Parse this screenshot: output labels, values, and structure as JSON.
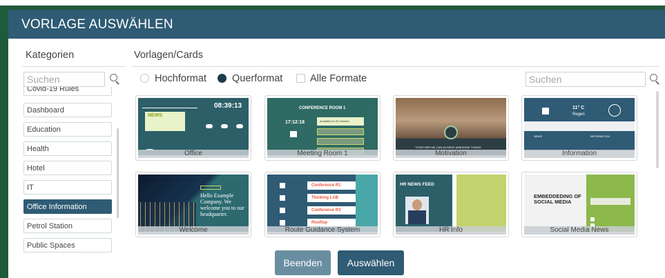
{
  "dialog": {
    "title": "VORLAGE AUSWÄHLEN"
  },
  "categories": {
    "header": "Kategorien",
    "search_placeholder": "Suchen",
    "items": [
      "Covid-19 Rules",
      "Dashboard",
      "Education",
      "Health",
      "Hotel",
      "IT",
      "Office Information",
      "Petrol Station",
      "Public Spaces"
    ],
    "selected": "Office Information"
  },
  "templates": {
    "header": "Vorlagen/Cards",
    "search_placeholder": "Suchen",
    "formats": [
      {
        "label": "Hochformat",
        "type": "radio",
        "checked": false
      },
      {
        "label": "Querformat",
        "type": "radio",
        "checked": true
      },
      {
        "label": "Alle Formate",
        "type": "checkbox",
        "checked": false
      }
    ],
    "cards": [
      {
        "caption": "Office",
        "thumb": {
          "clock": "08:39:13",
          "heading": "NEWS"
        }
      },
      {
        "caption": "Meeting Room 1",
        "thumb": {
          "heading": "CONFERENCE ROOM 1",
          "time": "17:12:18",
          "status": "Available for 33 minutes"
        }
      },
      {
        "caption": "Motivation",
        "thumb": {
          "slogan": "TOGETHER WE CAN ACHIEVE AWESOME THINGS"
        }
      },
      {
        "caption": "Information",
        "thumb": {
          "temp": "11° C",
          "weather": "Regen",
          "news": "NEWS",
          "info": "INFORMATION"
        }
      },
      {
        "caption": "Welcome",
        "thumb": {
          "text": "Hello Example Company. We welcome you to our headquarter."
        }
      },
      {
        "caption": "Route Guidance System",
        "thumb": {
          "rooms": [
            "Conference R1",
            "Thinking LAB",
            "Conference R3",
            "Rooftop"
          ]
        }
      },
      {
        "caption": "HR Info",
        "thumb": {
          "heading": "HR NEWS FEED"
        }
      },
      {
        "caption": "Social Media News",
        "thumb": {
          "heading": "EMBEDDEDING OF SOCIAL MEDIA"
        }
      }
    ]
  },
  "buttons": {
    "cancel": "Beenden",
    "select": "Auswählen"
  }
}
